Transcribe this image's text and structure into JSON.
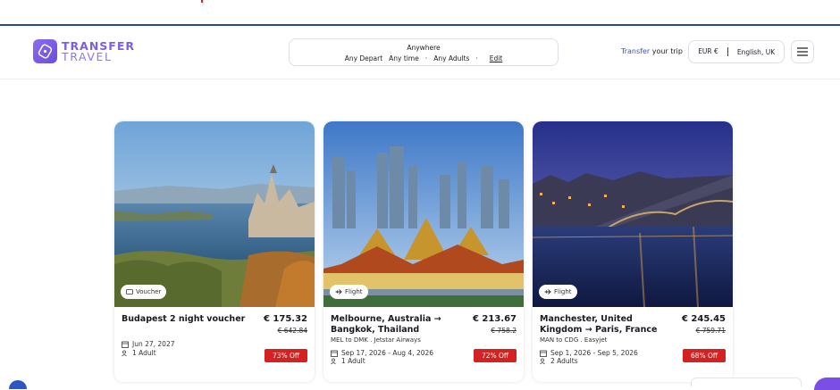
{
  "brand": {
    "line1": "TRANSFER",
    "line2": "TRAVEL"
  },
  "search": {
    "where": "Anywhere",
    "depart": "Any Depart",
    "time": "Any time",
    "adults": "Any Adults",
    "edit": "Edit"
  },
  "nav": {
    "transfer_accent": "Transfer",
    "transfer_rest": "your trip",
    "currency": "EUR €",
    "language": "English, UK"
  },
  "cards": [
    {
      "badge": "Voucher",
      "title": "Budapest 2 night voucher",
      "price": "€ 175.32",
      "old_price": "€ 642.84",
      "subtitle": "",
      "date": "Jun 27, 2027",
      "travellers": "1 Adult",
      "discount": "73% Off"
    },
    {
      "badge": "Flight",
      "title": "Melbourne, Australia → Bangkok, Thailand",
      "price": "€ 213.67",
      "old_price": "€ 758.2",
      "subtitle": "MEL to DMK . Jetstar Airways",
      "date": "Sep 17, 2026 - Aug 4, 2026",
      "travellers": "1 Adult",
      "discount": "72% Off"
    },
    {
      "badge": "Flight",
      "title": "Manchester, United Kingdom → Paris, France",
      "price": "€ 245.45",
      "old_price": "€ 759.71",
      "subtitle": "MAN to CDG . Easyjet",
      "date": "Sep 1, 2026 - Sep 5, 2026",
      "travellers": "2 Adults",
      "discount": "68% Off"
    }
  ],
  "colors": {
    "accent": "#7b5ee6",
    "discount": "#d42222",
    "link": "#3d4ec6"
  }
}
